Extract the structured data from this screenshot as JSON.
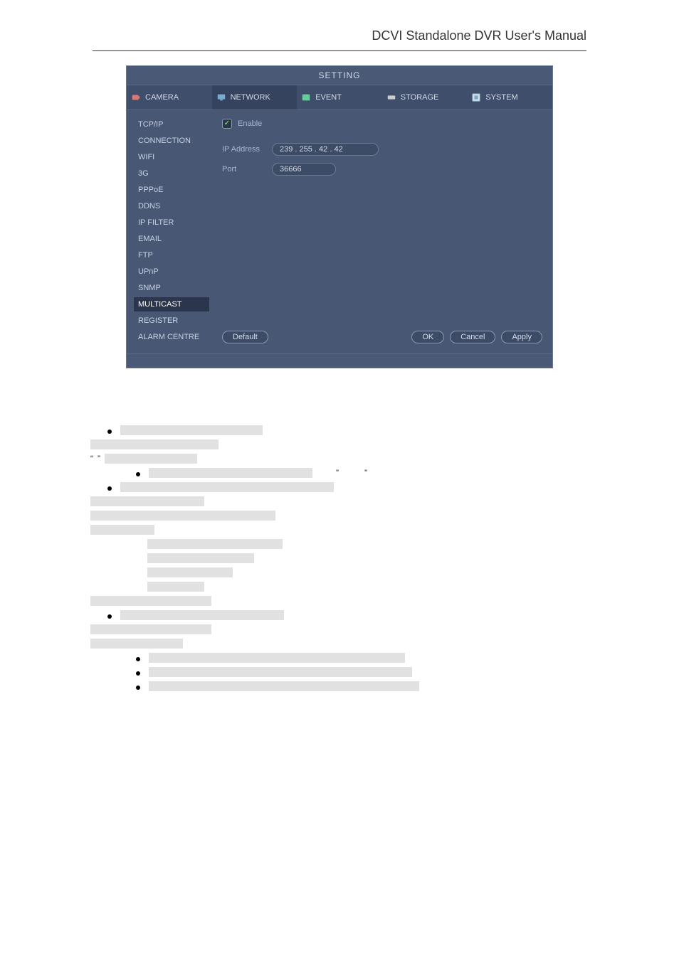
{
  "manual_title": "DCVI Standalone DVR User's Manual",
  "dialog": {
    "title": "SETTING",
    "tabs": {
      "camera": "CAMERA",
      "network": "NETWORK",
      "event": "EVENT",
      "storage": "STORAGE",
      "system": "SYSTEM"
    },
    "sidenav": {
      "items": [
        "TCP/IP",
        "CONNECTION",
        "WIFI",
        "3G",
        "PPPoE",
        "DDNS",
        "IP FILTER",
        "EMAIL",
        "FTP",
        "UPnP",
        "SNMP",
        "MULTICAST",
        "REGISTER",
        "ALARM CENTRE"
      ],
      "selected_index": 11
    },
    "form": {
      "enable_label": "Enable",
      "enable_checked": true,
      "ip_label": "IP Address",
      "ip_value": "239 . 255 .  42  .  42",
      "port_label": "Port",
      "port_value": "36666"
    },
    "buttons": {
      "default": "Default",
      "ok": "OK",
      "cancel": "Cancel",
      "apply": "Apply"
    }
  },
  "doc_body": {
    "open_quote": "“",
    "close_quote": "”",
    "mid_dbl_a": "”",
    "mid_dbl_b": "”"
  }
}
